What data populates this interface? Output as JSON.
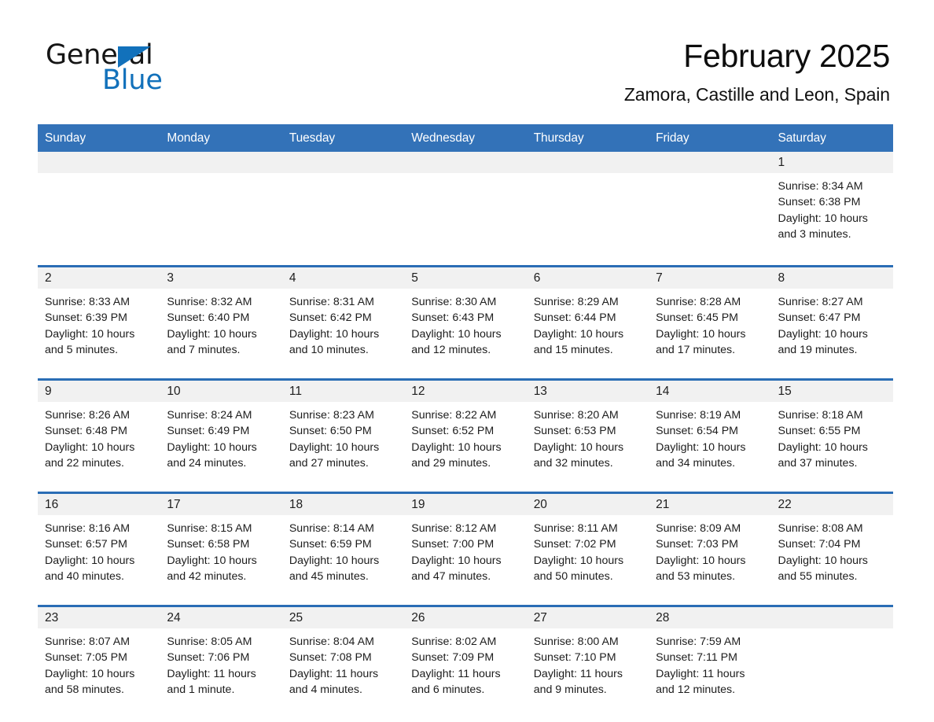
{
  "brand": {
    "name_part1": "General",
    "name_part2": "Blue",
    "accent_color": "#1271bb"
  },
  "header": {
    "month_title": "February 2025",
    "location": "Zamora, Castille and Leon, Spain"
  },
  "calendar": {
    "header_color": "#3372b8",
    "row_divider_color": "#2a6db5",
    "daynum_band_color": "#f1f1f1",
    "weekday_headers": [
      "Sunday",
      "Monday",
      "Tuesday",
      "Wednesday",
      "Thursday",
      "Friday",
      "Saturday"
    ],
    "weeks": [
      [
        {
          "day": "",
          "sunrise": "",
          "sunset": "",
          "daylight": "",
          "empty": true
        },
        {
          "day": "",
          "sunrise": "",
          "sunset": "",
          "daylight": "",
          "empty": true
        },
        {
          "day": "",
          "sunrise": "",
          "sunset": "",
          "daylight": "",
          "empty": true
        },
        {
          "day": "",
          "sunrise": "",
          "sunset": "",
          "daylight": "",
          "empty": true
        },
        {
          "day": "",
          "sunrise": "",
          "sunset": "",
          "daylight": "",
          "empty": true
        },
        {
          "day": "",
          "sunrise": "",
          "sunset": "",
          "daylight": "",
          "empty": true
        },
        {
          "day": "1",
          "sunrise": "Sunrise: 8:34 AM",
          "sunset": "Sunset: 6:38 PM",
          "daylight": "Daylight: 10 hours and 3 minutes.",
          "empty": false
        }
      ],
      [
        {
          "day": "2",
          "sunrise": "Sunrise: 8:33 AM",
          "sunset": "Sunset: 6:39 PM",
          "daylight": "Daylight: 10 hours and 5 minutes.",
          "empty": false
        },
        {
          "day": "3",
          "sunrise": "Sunrise: 8:32 AM",
          "sunset": "Sunset: 6:40 PM",
          "daylight": "Daylight: 10 hours and 7 minutes.",
          "empty": false
        },
        {
          "day": "4",
          "sunrise": "Sunrise: 8:31 AM",
          "sunset": "Sunset: 6:42 PM",
          "daylight": "Daylight: 10 hours and 10 minutes.",
          "empty": false
        },
        {
          "day": "5",
          "sunrise": "Sunrise: 8:30 AM",
          "sunset": "Sunset: 6:43 PM",
          "daylight": "Daylight: 10 hours and 12 minutes.",
          "empty": false
        },
        {
          "day": "6",
          "sunrise": "Sunrise: 8:29 AM",
          "sunset": "Sunset: 6:44 PM",
          "daylight": "Daylight: 10 hours and 15 minutes.",
          "empty": false
        },
        {
          "day": "7",
          "sunrise": "Sunrise: 8:28 AM",
          "sunset": "Sunset: 6:45 PM",
          "daylight": "Daylight: 10 hours and 17 minutes.",
          "empty": false
        },
        {
          "day": "8",
          "sunrise": "Sunrise: 8:27 AM",
          "sunset": "Sunset: 6:47 PM",
          "daylight": "Daylight: 10 hours and 19 minutes.",
          "empty": false
        }
      ],
      [
        {
          "day": "9",
          "sunrise": "Sunrise: 8:26 AM",
          "sunset": "Sunset: 6:48 PM",
          "daylight": "Daylight: 10 hours and 22 minutes.",
          "empty": false
        },
        {
          "day": "10",
          "sunrise": "Sunrise: 8:24 AM",
          "sunset": "Sunset: 6:49 PM",
          "daylight": "Daylight: 10 hours and 24 minutes.",
          "empty": false
        },
        {
          "day": "11",
          "sunrise": "Sunrise: 8:23 AM",
          "sunset": "Sunset: 6:50 PM",
          "daylight": "Daylight: 10 hours and 27 minutes.",
          "empty": false
        },
        {
          "day": "12",
          "sunrise": "Sunrise: 8:22 AM",
          "sunset": "Sunset: 6:52 PM",
          "daylight": "Daylight: 10 hours and 29 minutes.",
          "empty": false
        },
        {
          "day": "13",
          "sunrise": "Sunrise: 8:20 AM",
          "sunset": "Sunset: 6:53 PM",
          "daylight": "Daylight: 10 hours and 32 minutes.",
          "empty": false
        },
        {
          "day": "14",
          "sunrise": "Sunrise: 8:19 AM",
          "sunset": "Sunset: 6:54 PM",
          "daylight": "Daylight: 10 hours and 34 minutes.",
          "empty": false
        },
        {
          "day": "15",
          "sunrise": "Sunrise: 8:18 AM",
          "sunset": "Sunset: 6:55 PM",
          "daylight": "Daylight: 10 hours and 37 minutes.",
          "empty": false
        }
      ],
      [
        {
          "day": "16",
          "sunrise": "Sunrise: 8:16 AM",
          "sunset": "Sunset: 6:57 PM",
          "daylight": "Daylight: 10 hours and 40 minutes.",
          "empty": false
        },
        {
          "day": "17",
          "sunrise": "Sunrise: 8:15 AM",
          "sunset": "Sunset: 6:58 PM",
          "daylight": "Daylight: 10 hours and 42 minutes.",
          "empty": false
        },
        {
          "day": "18",
          "sunrise": "Sunrise: 8:14 AM",
          "sunset": "Sunset: 6:59 PM",
          "daylight": "Daylight: 10 hours and 45 minutes.",
          "empty": false
        },
        {
          "day": "19",
          "sunrise": "Sunrise: 8:12 AM",
          "sunset": "Sunset: 7:00 PM",
          "daylight": "Daylight: 10 hours and 47 minutes.",
          "empty": false
        },
        {
          "day": "20",
          "sunrise": "Sunrise: 8:11 AM",
          "sunset": "Sunset: 7:02 PM",
          "daylight": "Daylight: 10 hours and 50 minutes.",
          "empty": false
        },
        {
          "day": "21",
          "sunrise": "Sunrise: 8:09 AM",
          "sunset": "Sunset: 7:03 PM",
          "daylight": "Daylight: 10 hours and 53 minutes.",
          "empty": false
        },
        {
          "day": "22",
          "sunrise": "Sunrise: 8:08 AM",
          "sunset": "Sunset: 7:04 PM",
          "daylight": "Daylight: 10 hours and 55 minutes.",
          "empty": false
        }
      ],
      [
        {
          "day": "23",
          "sunrise": "Sunrise: 8:07 AM",
          "sunset": "Sunset: 7:05 PM",
          "daylight": "Daylight: 10 hours and 58 minutes.",
          "empty": false
        },
        {
          "day": "24",
          "sunrise": "Sunrise: 8:05 AM",
          "sunset": "Sunset: 7:06 PM",
          "daylight": "Daylight: 11 hours and 1 minute.",
          "empty": false
        },
        {
          "day": "25",
          "sunrise": "Sunrise: 8:04 AM",
          "sunset": "Sunset: 7:08 PM",
          "daylight": "Daylight: 11 hours and 4 minutes.",
          "empty": false
        },
        {
          "day": "26",
          "sunrise": "Sunrise: 8:02 AM",
          "sunset": "Sunset: 7:09 PM",
          "daylight": "Daylight: 11 hours and 6 minutes.",
          "empty": false
        },
        {
          "day": "27",
          "sunrise": "Sunrise: 8:00 AM",
          "sunset": "Sunset: 7:10 PM",
          "daylight": "Daylight: 11 hours and 9 minutes.",
          "empty": false
        },
        {
          "day": "28",
          "sunrise": "Sunrise: 7:59 AM",
          "sunset": "Sunset: 7:11 PM",
          "daylight": "Daylight: 11 hours and 12 minutes.",
          "empty": false
        },
        {
          "day": "",
          "sunrise": "",
          "sunset": "",
          "daylight": "",
          "empty": true
        }
      ]
    ]
  }
}
